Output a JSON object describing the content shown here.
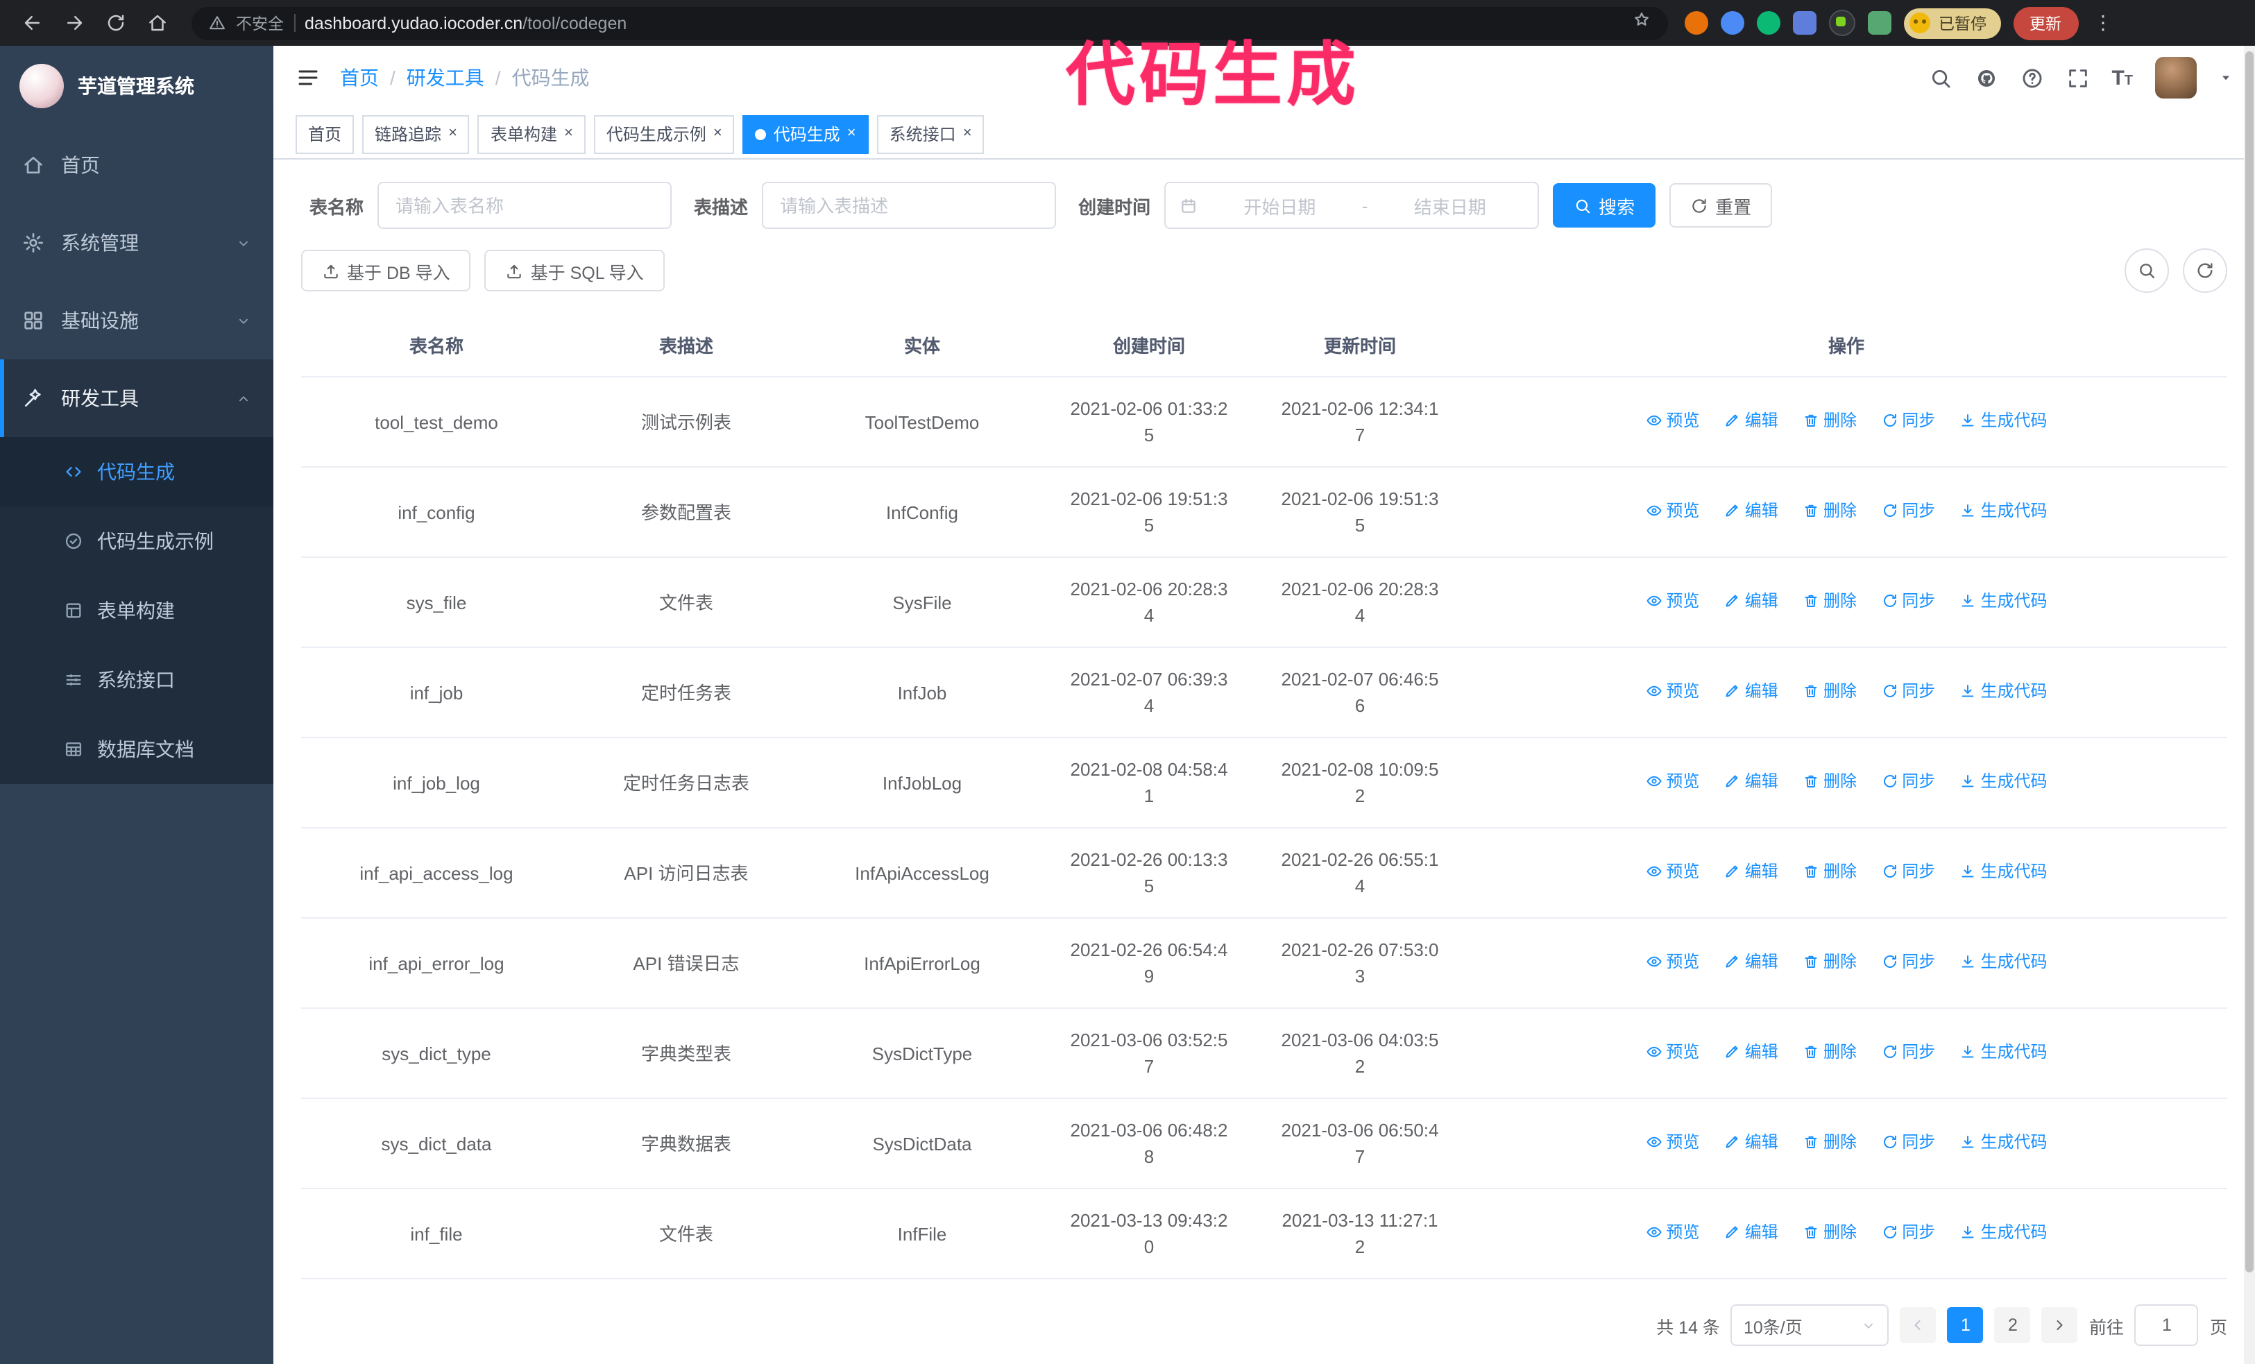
{
  "theme": {
    "accent": "#1890ff",
    "sidebar_bg": "#304156",
    "submenu_bg": "#1f2d3d",
    "tab_active_bg": "#1890ff",
    "annotation_color": "#fb2b68"
  },
  "annotation": {
    "text": "代码生成"
  },
  "browser": {
    "security_label": "不安全",
    "url_host": "dashboard.yudao.iocoder.cn",
    "url_path": "/tool/codegen",
    "paused_badge": "已暂停",
    "update_button": "更新"
  },
  "icons": {
    "tab_close": "×",
    "kebab": "⋮",
    "breadcrumb_separator": "/",
    "font_size_large": "T",
    "font_size_small": "T"
  },
  "sidebar": {
    "logo_title": "芋道管理系统",
    "items": [
      {
        "label": "首页",
        "icon": "home-icon"
      },
      {
        "label": "系统管理",
        "icon": "gear-icon",
        "chevron": "down"
      },
      {
        "label": "基础设施",
        "icon": "grid-icon",
        "chevron": "down"
      },
      {
        "label": "研发工具",
        "icon": "tools-icon",
        "chevron": "up",
        "expanded": true
      }
    ],
    "subitems": [
      {
        "label": "代码生成",
        "icon": "code-icon",
        "active": true
      },
      {
        "label": "代码生成示例",
        "icon": "badge-check-icon"
      },
      {
        "label": "表单构建",
        "icon": "form-icon"
      },
      {
        "label": "系统接口",
        "icon": "sliders-icon"
      },
      {
        "label": "数据库文档",
        "icon": "table-grid-icon"
      }
    ]
  },
  "header": {
    "breadcrumb": [
      "首页",
      "研发工具",
      "代码生成"
    ]
  },
  "tabs": [
    {
      "label": "首页",
      "closable": false,
      "active": false
    },
    {
      "label": "链路追踪",
      "closable": true,
      "active": false
    },
    {
      "label": "表单构建",
      "closable": true,
      "active": false
    },
    {
      "label": "代码生成示例",
      "closable": true,
      "active": false
    },
    {
      "label": "代码生成",
      "closable": true,
      "active": true
    },
    {
      "label": "系统接口",
      "closable": true,
      "active": false
    }
  ],
  "filters": {
    "table_name_label": "表名称",
    "table_name_placeholder": "请输入表名称",
    "table_desc_label": "表描述",
    "table_desc_placeholder": "请输入表描述",
    "create_time_label": "创建时间",
    "date_start_placeholder": "开始日期",
    "date_separator": "-",
    "date_end_placeholder": "结束日期",
    "search_button": "搜索",
    "reset_button": "重置"
  },
  "toolbar": {
    "import_db_label": "基于 DB 导入",
    "import_sql_label": "基于 SQL 导入"
  },
  "table": {
    "columns": [
      "表名称",
      "表描述",
      "实体",
      "创建时间",
      "更新时间",
      "操作"
    ],
    "actions": [
      "预览",
      "编辑",
      "删除",
      "同步",
      "生成代码"
    ],
    "rows": [
      {
        "name": "tool_test_demo",
        "desc": "测试示例表",
        "entity": "ToolTestDemo",
        "created": "2021-02-06 01:33:25",
        "updated": "2021-02-06 12:34:17"
      },
      {
        "name": "inf_config",
        "desc": "参数配置表",
        "entity": "InfConfig",
        "created": "2021-02-06 19:51:35",
        "updated": "2021-02-06 19:51:35"
      },
      {
        "name": "sys_file",
        "desc": "文件表",
        "entity": "SysFile",
        "created": "2021-02-06 20:28:34",
        "updated": "2021-02-06 20:28:34"
      },
      {
        "name": "inf_job",
        "desc": "定时任务表",
        "entity": "InfJob",
        "created": "2021-02-07 06:39:34",
        "updated": "2021-02-07 06:46:56"
      },
      {
        "name": "inf_job_log",
        "desc": "定时任务日志表",
        "entity": "InfJobLog",
        "created": "2021-02-08 04:58:41",
        "updated": "2021-02-08 10:09:52"
      },
      {
        "name": "inf_api_access_log",
        "desc": "API 访问日志表",
        "entity": "InfApiAccessLog",
        "created": "2021-02-26 00:13:35",
        "updated": "2021-02-26 06:55:14"
      },
      {
        "name": "inf_api_error_log",
        "desc": "API 错误日志",
        "entity": "InfApiErrorLog",
        "created": "2021-02-26 06:54:49",
        "updated": "2021-02-26 07:53:03"
      },
      {
        "name": "sys_dict_type",
        "desc": "字典类型表",
        "entity": "SysDictType",
        "created": "2021-03-06 03:52:57",
        "updated": "2021-03-06 04:03:52"
      },
      {
        "name": "sys_dict_data",
        "desc": "字典数据表",
        "entity": "SysDictData",
        "created": "2021-03-06 06:48:28",
        "updated": "2021-03-06 06:50:47"
      },
      {
        "name": "inf_file",
        "desc": "文件表",
        "entity": "InfFile",
        "created": "2021-03-13 09:43:20",
        "updated": "2021-03-13 11:27:12"
      }
    ]
  },
  "pagination": {
    "total_label": "共 14 条",
    "page_size_label": "10条/页",
    "pages": [
      "1",
      "2"
    ],
    "active_page": "1",
    "goto_label": "前往",
    "goto_value": "1",
    "goto_suffix": "页"
  }
}
